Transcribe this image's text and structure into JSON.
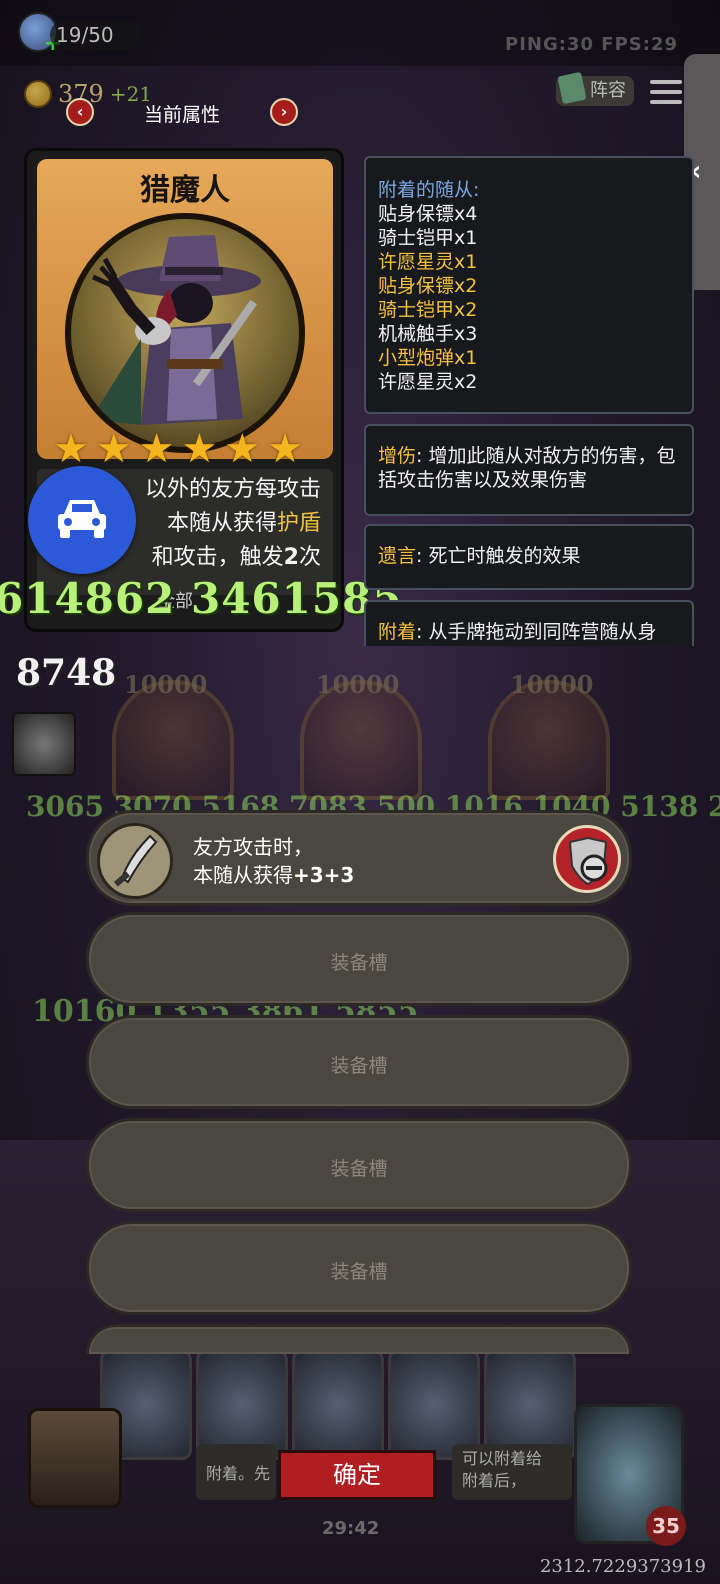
{
  "top_bar": {
    "player_count": "19/50",
    "net_stats": "PING:30  FPS:29",
    "gold": "379",
    "gold_income": "+21",
    "lineup_label": "阵容"
  },
  "attribute_header": {
    "title": "当前属性",
    "prev_arrow": "‹",
    "next_arrow": "›"
  },
  "hero_card": {
    "name": "猎魔人",
    "star_count": 6,
    "desc_line1": "以外的友方每攻击",
    "desc_line2_a": "本随从获得",
    "desc_line2_b": "护盾",
    "desc_line3_a": "和攻击，触发",
    "desc_line3_b": "2",
    "desc_line3_c": "次",
    "badge": "全部"
  },
  "attached_panel": {
    "title": "附着的随从:",
    "items": [
      {
        "text": "贴身保镖x4",
        "gold": false
      },
      {
        "text": "骑士铠甲x1",
        "gold": false
      },
      {
        "text": "许愿星灵x1",
        "gold": true
      },
      {
        "text": "贴身保镖x2",
        "gold": true
      },
      {
        "text": "骑士铠甲x2",
        "gold": true
      },
      {
        "text": "机械触手x3",
        "gold": false
      },
      {
        "text": "小型炮弹x1",
        "gold": true
      },
      {
        "text": "许愿星灵x2",
        "gold": false
      }
    ]
  },
  "keywords": [
    {
      "keyword": "增伤",
      "text": ": 增加此随从对敌方的伤害，包括攻击伤害以及效果伤害"
    },
    {
      "keyword": "遗言",
      "text": ": 死亡时触发的效果"
    },
    {
      "keyword": "附着",
      "text": ": 从手牌拖动到同阵营随从身"
    }
  ],
  "background": {
    "damage_big": "614862 3461585",
    "count": "8748",
    "slot_values": [
      "10000",
      "10000",
      "10000"
    ],
    "green_row1": "3065 3070 5168 7083 500 1016 1040 5138 2",
    "green_row2": "10160 1355 3861 5855"
  },
  "equipment": {
    "filled": {
      "line1": "友方攻击时，",
      "line2_a": "本随从获得",
      "line2_b": "+3+3"
    },
    "empty_label": "装备槽"
  },
  "bottom": {
    "confirm_label": "确定",
    "tooltip_left": "附着。先",
    "tooltip_right_1": "可以附着给",
    "tooltip_right_2": "附着后，",
    "timer": "29:42",
    "hp": "35",
    "coord": "2312.7229373919"
  },
  "colors": {
    "accent_red": "#b01e22",
    "gold_text": "#f2c040",
    "keyword_blue": "#7aa8e0",
    "fab_blue": "#2c59d8",
    "damage_green": "#b9f07a"
  }
}
